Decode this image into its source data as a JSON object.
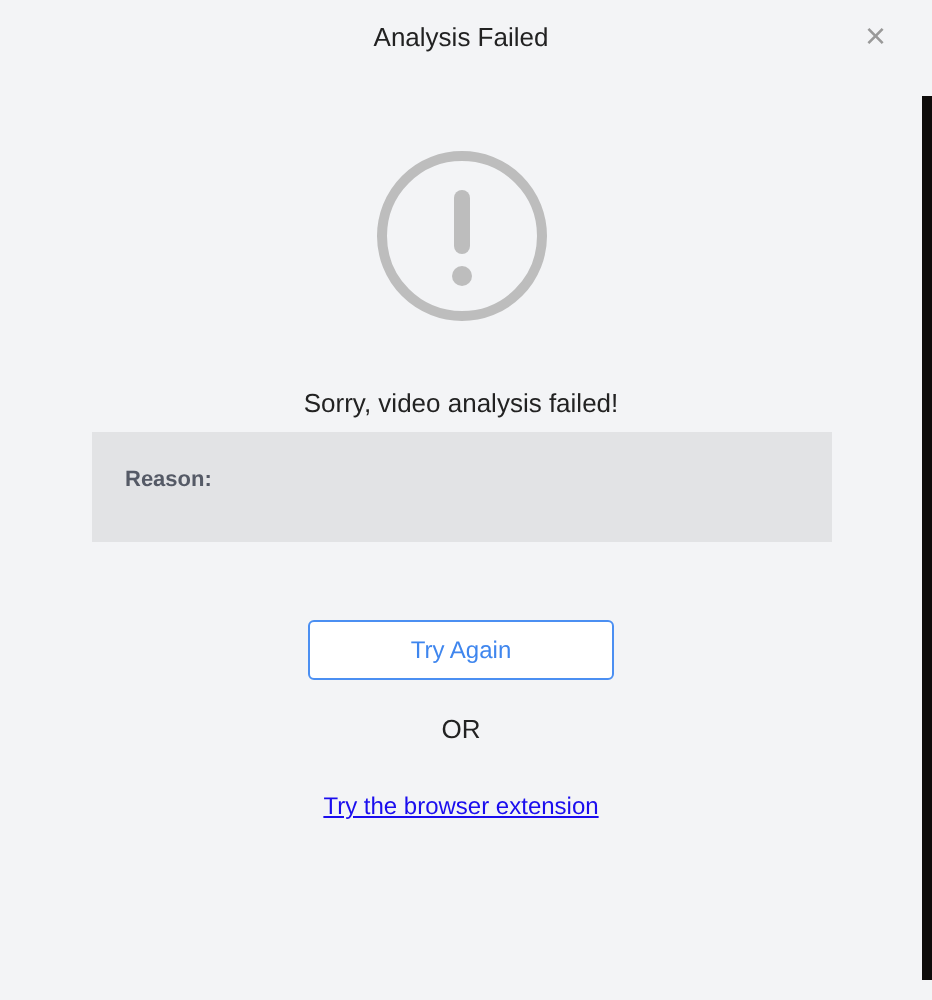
{
  "dialog": {
    "title": "Analysis Failed",
    "close": "×",
    "message": "Sorry, video analysis failed!",
    "reason_label": "Reason:",
    "primary_button": "Try Again",
    "separator": "OR",
    "link": "Try the browser extension"
  }
}
